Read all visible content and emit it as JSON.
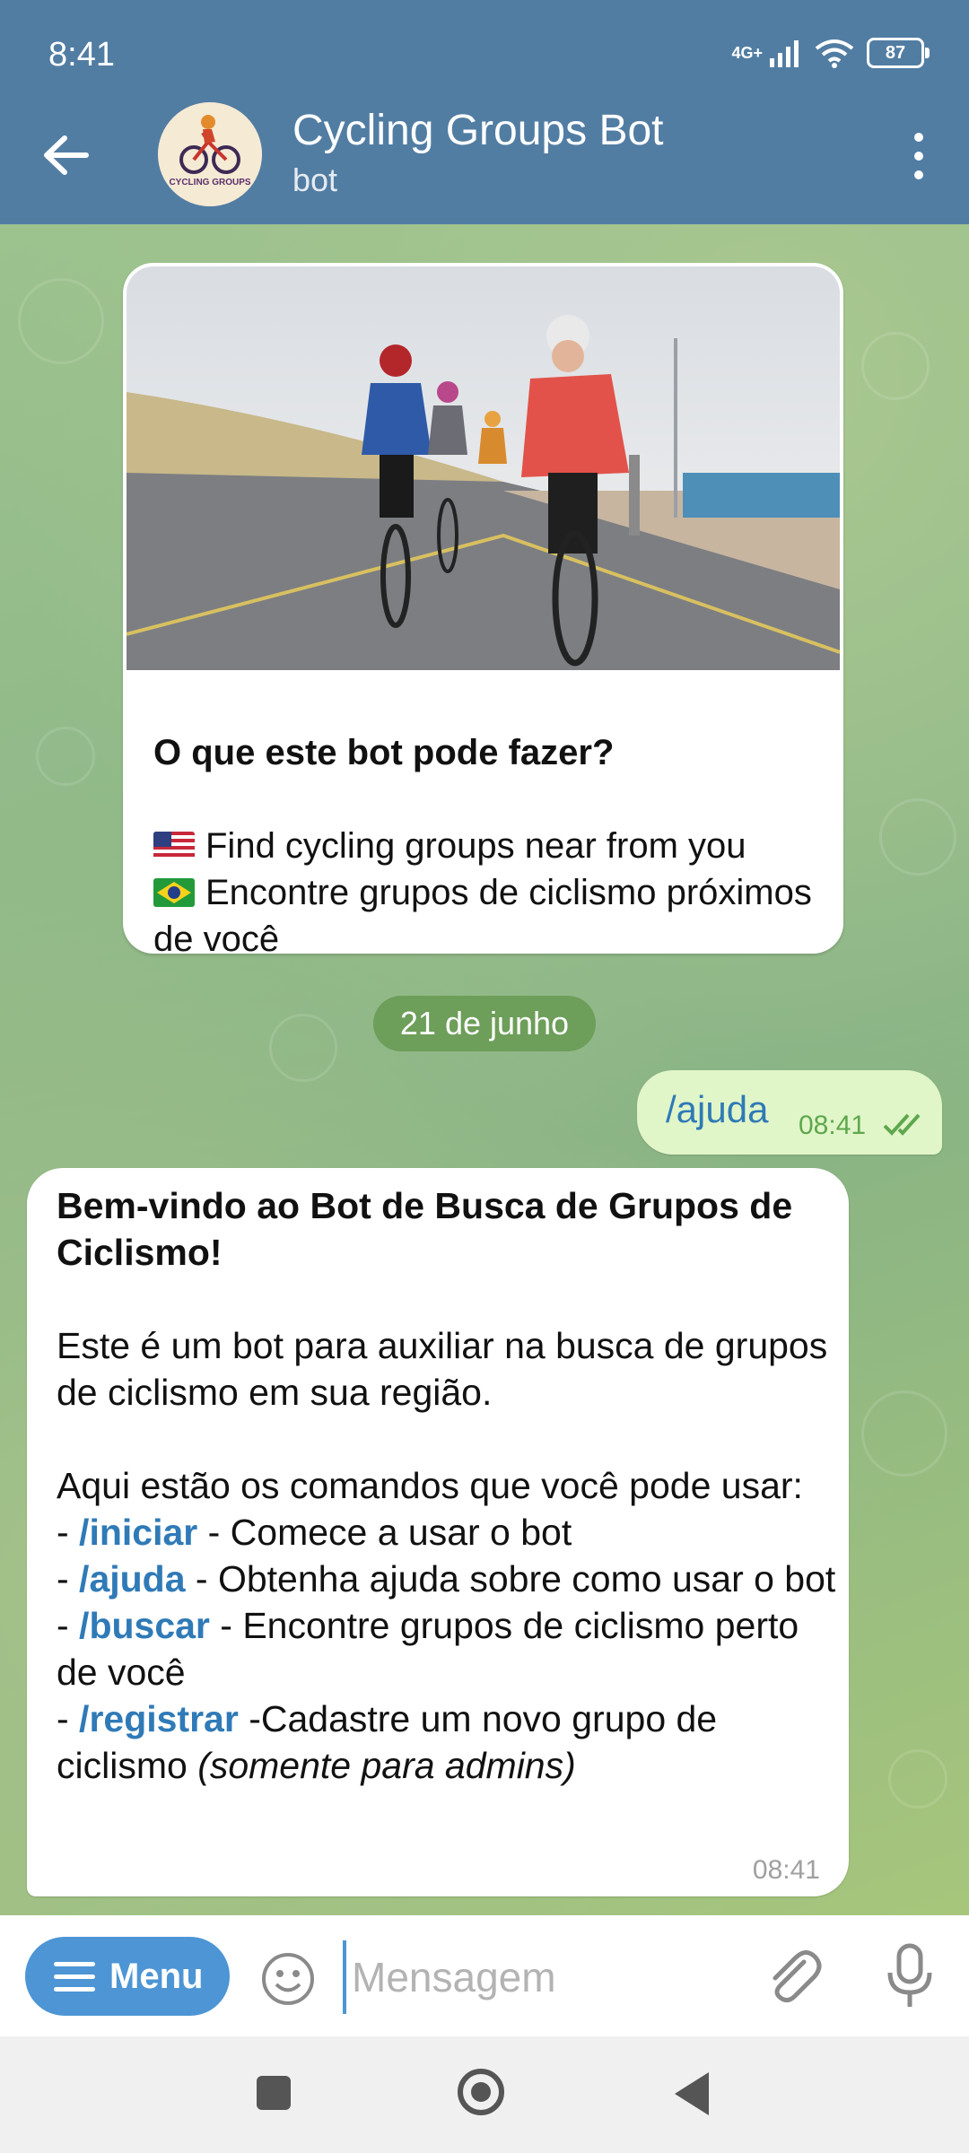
{
  "status_bar": {
    "time": "8:41",
    "network": "4G+",
    "battery": "87"
  },
  "header": {
    "title": "Cycling Groups Bot",
    "subtitle": "bot",
    "avatar_text": "CYCLING GROUPS"
  },
  "intro_card": {
    "heading": "O que este bot pode fazer?",
    "line_en": "Find cycling groups near from you",
    "line_pt": "Encontre grupos de ciclismo próximos de você"
  },
  "date_separator": "21 de junho",
  "outgoing_message": {
    "text": "/ajuda",
    "time": "08:41"
  },
  "incoming_message": {
    "title": "Bem-vindo ao Bot de Busca de Grupos de Ciclismo!",
    "intro": "Este é um bot para auxiliar na busca de grupos de ciclismo em sua região.",
    "commands_intro": "Aqui estão os comandos que você pode usar:",
    "commands": [
      {
        "cmd": "/iniciar",
        "desc": " - Comece a usar o bot"
      },
      {
        "cmd": "/ajuda",
        "desc": " - Obtenha ajuda sobre como usar o bot"
      },
      {
        "cmd": "/buscar",
        "desc": " - Encontre grupos de ciclismo perto de você"
      },
      {
        "cmd": "/registrar",
        "desc": " -Cadastre um novo grupo de ciclismo "
      }
    ],
    "admin_note": "(somente para admins)",
    "time": "08:41"
  },
  "input_bar": {
    "menu_label": "Menu",
    "placeholder": "Mensagem"
  },
  "colors": {
    "header": "#527da3",
    "accent": "#4d95d4",
    "link": "#2f7ab7",
    "outgoing_bubble": "#e1f6c8"
  }
}
